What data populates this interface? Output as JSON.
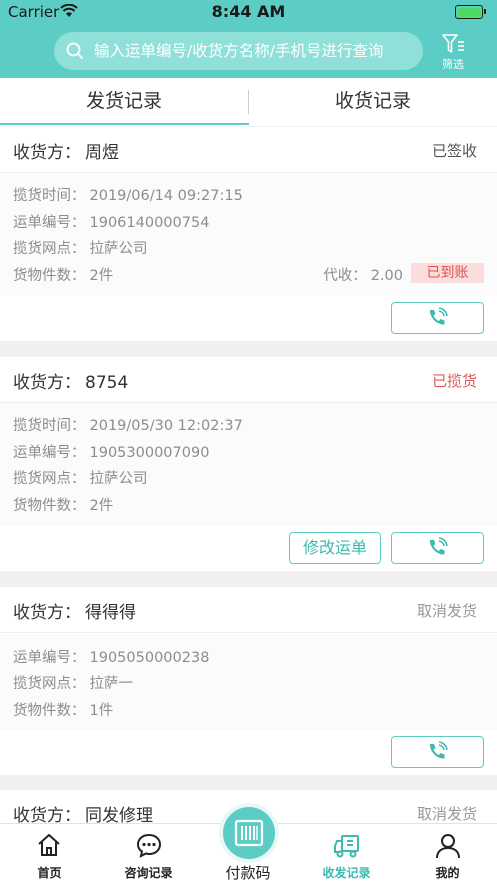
{
  "status_bar": {
    "carrier": "Carrier",
    "time": "8:44 AM"
  },
  "search": {
    "placeholder": "输入运单编号/收货方名称/手机号进行查询"
  },
  "filter": {
    "label": "筛选"
  },
  "tabs": [
    {
      "label": "发货记录",
      "active": true
    },
    {
      "label": "收货记录",
      "active": false
    }
  ],
  "labels": {
    "consignee": "收货方：",
    "pickup_time": "揽货时间：",
    "waybill_no": "运单编号：",
    "pickup_point": "揽货网点：",
    "item_count": "货物件数：",
    "cod": "代收："
  },
  "records": [
    {
      "consignee": "周煜",
      "status": "已签收",
      "pickup_time": "2019/06/14 09:27:15",
      "waybill_no": "1906140000754",
      "pickup_point": "拉萨公司",
      "item_count": "2件",
      "cod_amount": "2.00",
      "payment_badge": "已到账"
    },
    {
      "consignee": "8754",
      "status": "已揽货",
      "pickup_time": "2019/05/30 12:02:37",
      "waybill_no": "1905300007090",
      "pickup_point": "拉萨公司",
      "item_count": "2件",
      "edit_button": "修改运单"
    },
    {
      "consignee": "得得得",
      "status": "取消发货",
      "waybill_no": "1905050000238",
      "pickup_point": "拉萨一",
      "item_count": "1件"
    },
    {
      "consignee": "同发修理",
      "status": "取消发货"
    }
  ],
  "bottom_nav": [
    {
      "label": "首页",
      "icon": "home-icon"
    },
    {
      "label": "咨询记录",
      "icon": "chat-icon"
    },
    {
      "label": "付款码",
      "icon": "barcode-icon"
    },
    {
      "label": "收发记录",
      "icon": "truck-icon",
      "active": true
    },
    {
      "label": "我的",
      "icon": "user-icon"
    }
  ],
  "colors": {
    "accent": "#5ccdc4",
    "red": "#e05a5a",
    "muted": "#8d8d8d"
  }
}
